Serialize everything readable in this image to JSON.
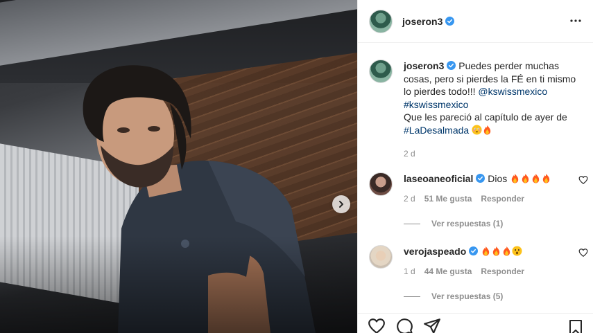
{
  "header": {
    "username": "joseron3"
  },
  "caption": {
    "username": "joseron3",
    "text_1": "Puedes perder muchas cosas, pero si pierdes la FÉ en ti mismo lo pierdes todo!!! ",
    "mention": "@kswissmexico",
    "hashtag_1": "#kswissmexico",
    "text_2": "Que les pareció al capítulo de ayer de",
    "hashtag_2": "#LaDesalmada",
    "time": "2 d"
  },
  "comments": [
    {
      "username": "laseoaneoficial",
      "text": "Dios",
      "time": "2 d",
      "likes": "51 Me gusta",
      "reply_label": "Responder",
      "view_replies": "Ver respuestas (1)"
    },
    {
      "username": "verojaspeado",
      "text": "",
      "time": "1 d",
      "likes": "44 Me gusta",
      "reply_label": "Responder",
      "view_replies": "Ver respuestas (5)"
    }
  ],
  "icons": {
    "verified_color": "#3897f0",
    "link_color": "#00376b",
    "muted_color": "#8e8e8e"
  }
}
